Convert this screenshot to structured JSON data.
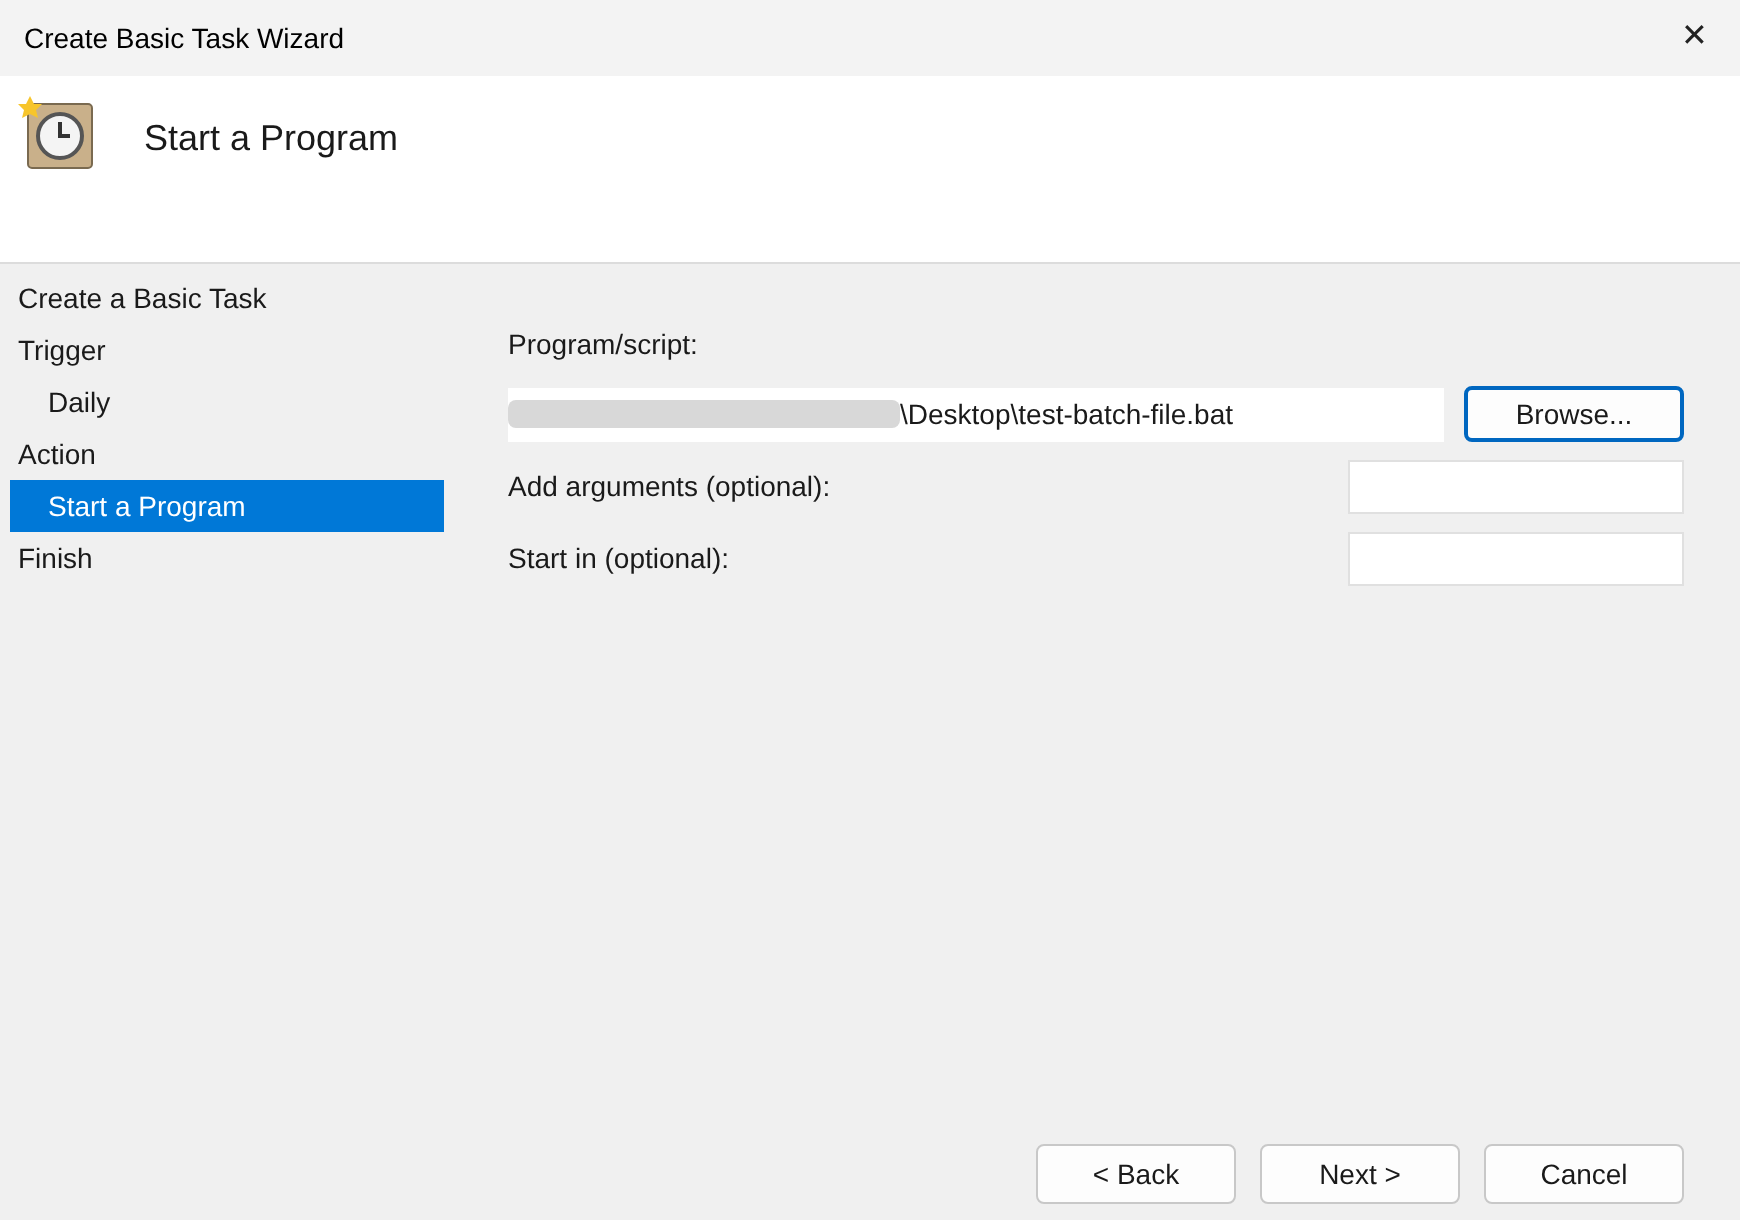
{
  "window": {
    "title": "Create Basic Task Wizard",
    "close": "✕"
  },
  "header": {
    "title": "Start a Program"
  },
  "steps": [
    {
      "label": "Create a Basic Task",
      "selected": false
    },
    {
      "label": "Trigger",
      "selected": false,
      "children": [
        {
          "label": "Daily",
          "selected": false
        }
      ]
    },
    {
      "label": "Action",
      "selected": false,
      "children": [
        {
          "label": "Start a Program",
          "selected": true
        }
      ]
    },
    {
      "label": "Finish",
      "selected": false
    }
  ],
  "form": {
    "program_label": "Program/script:",
    "program_value": "\\Desktop\\test-batch-file.bat",
    "browse": "Browse...",
    "fields": [
      {
        "label": "Add arguments (optional):"
      },
      {
        "label": "Start in (optional):"
      }
    ]
  },
  "buttons": [
    {
      "label": "< Back",
      "default": false
    },
    {
      "label": "Next >",
      "default": false
    },
    {
      "label": "Cancel",
      "default": false
    }
  ]
}
